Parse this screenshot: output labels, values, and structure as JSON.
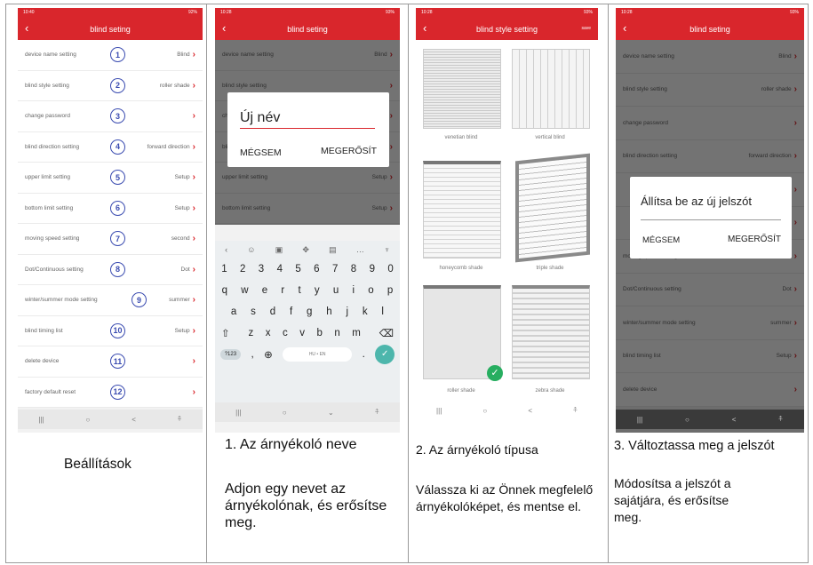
{
  "panel1": {
    "status_time": "10:40",
    "status_right": "92%",
    "title": "blind seting",
    "rows": [
      {
        "label": "device name setting",
        "value": "Blind",
        "num": "1"
      },
      {
        "label": "blind style setting",
        "value": "roller shade",
        "num": "2"
      },
      {
        "label": "change password",
        "value": "",
        "num": "3"
      },
      {
        "label": "blind direction setting",
        "value": "forward direction",
        "num": "4"
      },
      {
        "label": "upper limit setting",
        "value": "Setup",
        "num": "5"
      },
      {
        "label": "bottom limit setting",
        "value": "Setup",
        "num": "6"
      },
      {
        "label": "moving speed setting",
        "value": "second",
        "num": "7"
      },
      {
        "label": "Dot/Continuous setting",
        "value": "Dot",
        "num": "8"
      },
      {
        "label": "winter/summer mode setting",
        "value": "summer",
        "num": "9"
      },
      {
        "label": "blind timing list",
        "value": "Setup",
        "num": "10"
      },
      {
        "label": "delete device",
        "value": "",
        "num": "11"
      },
      {
        "label": "factory default reset",
        "value": "",
        "num": "12"
      }
    ],
    "caption": "Beállítások"
  },
  "panel2": {
    "status_time": "10:28",
    "status_right": "93%",
    "title": "blind seting",
    "rows_visible": [
      {
        "label": "device name setting",
        "value": "Blind"
      },
      {
        "label": "blind style setting",
        "value": ""
      },
      {
        "label": "change password",
        "value": ""
      },
      {
        "label": "blind direction setting",
        "value": ""
      },
      {
        "label": "upper limit setting",
        "value": "Setup"
      },
      {
        "label": "bottom limit setting",
        "value": "Setup"
      }
    ],
    "dialog_input": "Új név",
    "dialog_cancel": "MÉGSEM",
    "dialog_ok": "MEGERŐSÍT",
    "kb_numbers": [
      "1",
      "2",
      "3",
      "4",
      "5",
      "6",
      "7",
      "8",
      "9",
      "0"
    ],
    "kb_row1": [
      "q",
      "w",
      "e",
      "r",
      "t",
      "y",
      "u",
      "i",
      "o",
      "p"
    ],
    "kb_row2": [
      "a",
      "s",
      "d",
      "f",
      "g",
      "h",
      "j",
      "k",
      "l"
    ],
    "kb_row3": [
      "z",
      "x",
      "c",
      "v",
      "b",
      "n",
      "m"
    ],
    "kb_sym": "?123",
    "kb_space": "HU • EN",
    "caption_title": "1. Az árnyékoló neve",
    "caption_body": "Adjon egy nevet az árnyékolónak, és erősítse meg."
  },
  "panel3": {
    "status_time": "10:28",
    "status_right": "93%",
    "title": "blind style setting",
    "save": "save",
    "styles": [
      "venetian blind",
      "vertical blind",
      "honeycomb shade",
      "triple shade",
      "roller shade",
      "zebra shade"
    ],
    "selected": "roller shade",
    "caption_title": "2. Az árnyékoló típusa",
    "caption_body": "Válassza ki az Önnek megfelelő árnyékolóképet, és mentse el."
  },
  "panel4": {
    "status_time": "10:28",
    "status_right": "93%",
    "title": "blind seting",
    "rows_visible": [
      {
        "label": "device name setting",
        "value": "Blind"
      },
      {
        "label": "blind style setting",
        "value": "roller shade"
      },
      {
        "label": "change password",
        "value": ""
      },
      {
        "label": "blind direction setting",
        "value": "forward direction"
      },
      {
        "label": "",
        "value": ""
      },
      {
        "label": "",
        "value": ""
      },
      {
        "label": "moving speed setting",
        "value": "second"
      },
      {
        "label": "Dot/Continuous setting",
        "value": "Dot"
      },
      {
        "label": "winter/summer mode setting",
        "value": "summer"
      },
      {
        "label": "blind timing list",
        "value": "Setup"
      },
      {
        "label": "delete device",
        "value": ""
      }
    ],
    "dialog_title": "Állítsa be az új jelszót",
    "dialog_cancel": "MÉGSEM",
    "dialog_ok": "MEGERŐSÍT",
    "caption_title": "3. Változtassa meg a jelszót",
    "caption_body": "Módosítsa a jelszót a sajátjára, és erősítse meg."
  },
  "nav": {
    "recent": "|||",
    "home": "○",
    "back": "<",
    "access": "⍏"
  },
  "colors": {
    "accent": "#d9262c",
    "badge": "#3a4bb0",
    "check": "#27ae60"
  }
}
